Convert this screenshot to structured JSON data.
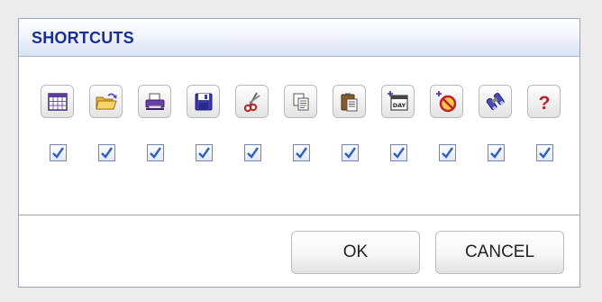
{
  "dialog": {
    "title": "SHORTCUTS",
    "ok_label": "OK",
    "cancel_label": "CANCEL"
  },
  "shortcuts": [
    {
      "icon": "calendar-grid-icon",
      "checked": true
    },
    {
      "icon": "open-folder-icon",
      "checked": true
    },
    {
      "icon": "printer-icon",
      "checked": true
    },
    {
      "icon": "save-disk-icon",
      "checked": true
    },
    {
      "icon": "scissors-cut-icon",
      "checked": true
    },
    {
      "icon": "copy-icon",
      "checked": true
    },
    {
      "icon": "paste-clipboard-icon",
      "checked": true
    },
    {
      "icon": "add-day-icon",
      "checked": true
    },
    {
      "icon": "add-no-entry-icon",
      "checked": true
    },
    {
      "icon": "binoculars-icon",
      "checked": true
    },
    {
      "icon": "help-question-icon",
      "checked": true
    }
  ],
  "colors": {
    "title": "#1b2f8e",
    "titlebar_bottom": "#d9e2f5",
    "border": "#9aa3b5",
    "checkmark": "#2f5fc4",
    "help": "#c0202a"
  }
}
